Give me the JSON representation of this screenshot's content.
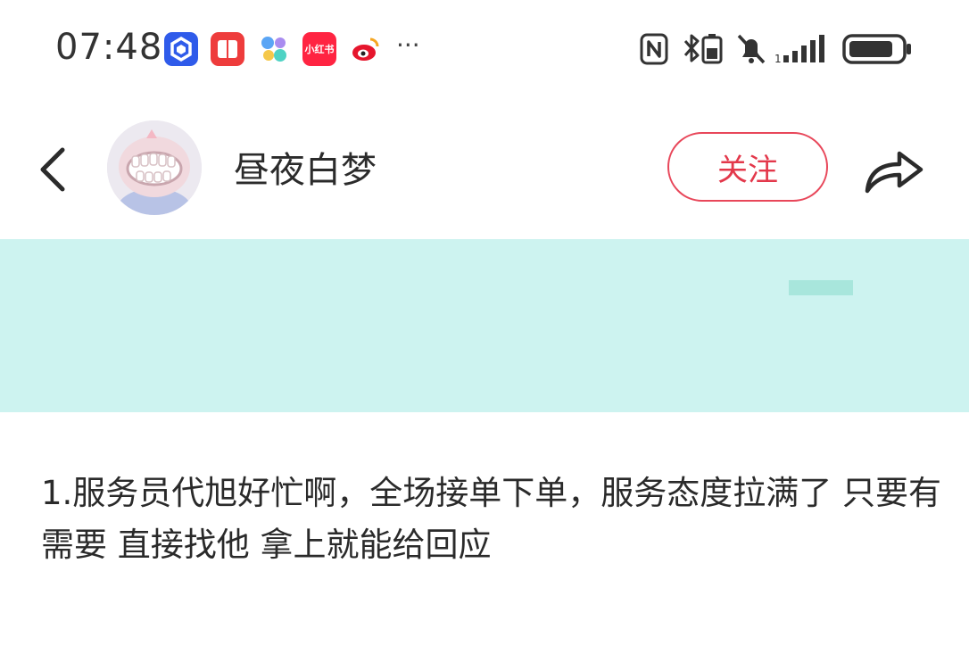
{
  "status_bar": {
    "time": "07:48",
    "more_indicator": "···",
    "notification_apps": [
      {
        "icon": "blue-hexagon-app-icon",
        "color": "#2f5bea"
      },
      {
        "icon": "red-book-app-icon",
        "color": "#ee3c3c"
      },
      {
        "icon": "colorful-dots-app-icon",
        "color": "#6ab8f5"
      },
      {
        "icon": "xiaohongshu-app-icon",
        "color": "#ff2442",
        "label": "小红书"
      },
      {
        "icon": "weibo-app-icon",
        "color": "#e6162d"
      }
    ],
    "system_icons": [
      "nfc-icon",
      "bluetooth-battery-icon",
      "mute-bell-icon",
      "signal-bars-icon",
      "battery-icon"
    ]
  },
  "header": {
    "username": "昼夜白梦",
    "follow_label": "关注",
    "accent_color": "#e3384b"
  },
  "banner": {
    "background": "#cdf3f0"
  },
  "post": {
    "text": "1.服务员代旭好忙啊，全场接单下单，服务态度拉满了 只要有需要 直接找他 拿上就能给回应"
  }
}
